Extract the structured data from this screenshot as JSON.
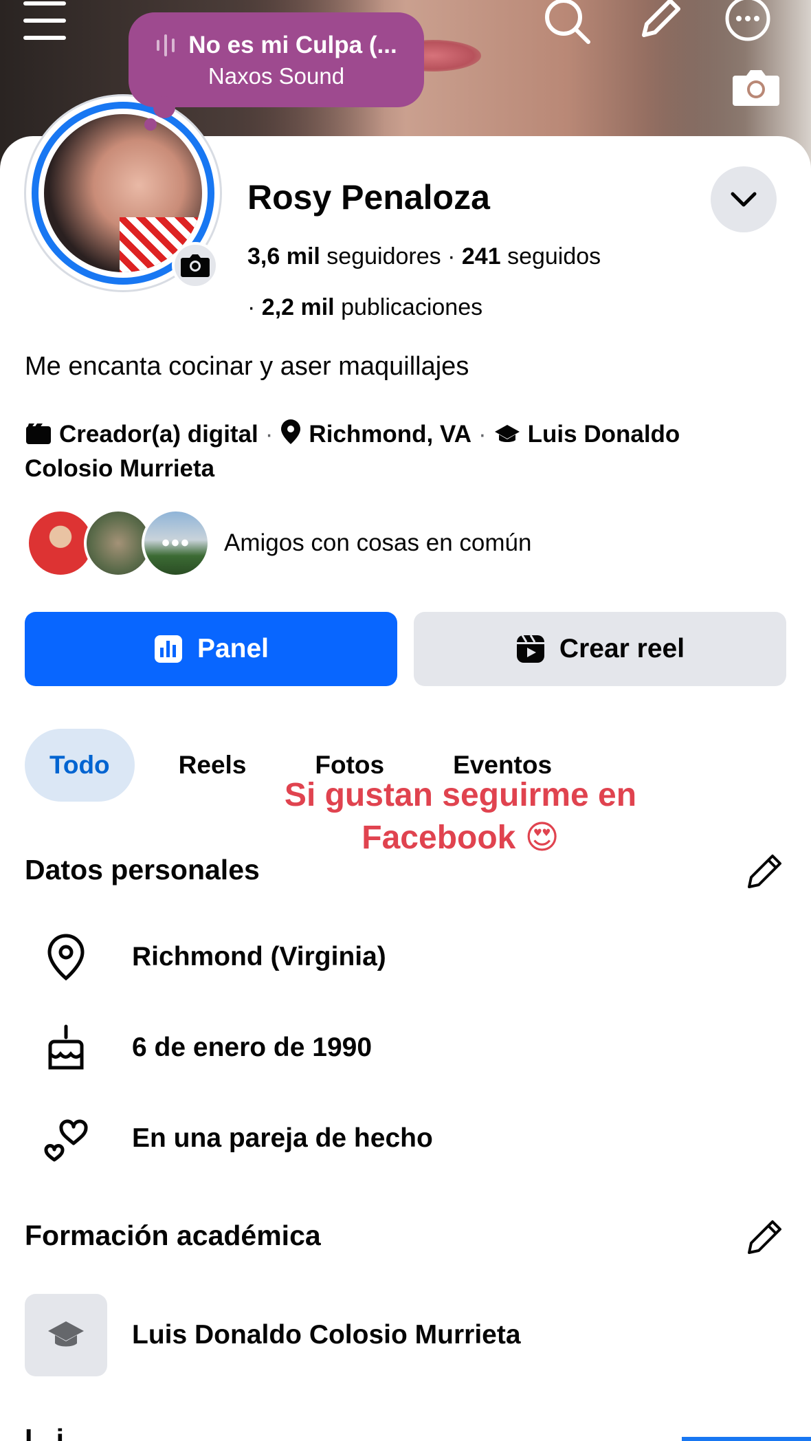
{
  "music": {
    "title": "No es mi Culpa (...",
    "artist": "Naxos Sound"
  },
  "profile": {
    "name": "Rosy Penaloza",
    "followers_count": "3,6 mil",
    "followers_label": "seguidores",
    "following_count": "241",
    "following_label": "seguidos",
    "posts_count": "2,2 mil",
    "posts_label": "publicaciones",
    "bio": "Me encanta cocinar y aser maquillajes",
    "category": "Creador(a) digital",
    "location": "Richmond, VA",
    "school_line1": "Luis Donaldo",
    "school_line2": "Colosio Murrieta"
  },
  "friends": {
    "label": "Amigos con cosas en común",
    "more": "•••"
  },
  "actions": {
    "panel_label": "Panel",
    "reel_label": "Crear reel"
  },
  "tabs": [
    "Todo",
    "Reels",
    "Fotos",
    "Eventos"
  ],
  "overlay": {
    "line1": "Si gustan seguirme en",
    "line2": "Facebook 😍"
  },
  "personal": {
    "title": "Datos personales",
    "location": "Richmond (Virginia)",
    "birthday": "6 de enero de 1990",
    "relationship": "En una pareja de hecho"
  },
  "education": {
    "title": "Formación académica",
    "school": "Luis Donaldo Colosio Murrieta"
  },
  "next_section_partial": "I...i...",
  "colors": {
    "accent": "#0866ff",
    "music_bubble": "#9e4a8f",
    "overlay_text": "#e0434f",
    "active_tab_bg": "#dbe7f5"
  }
}
